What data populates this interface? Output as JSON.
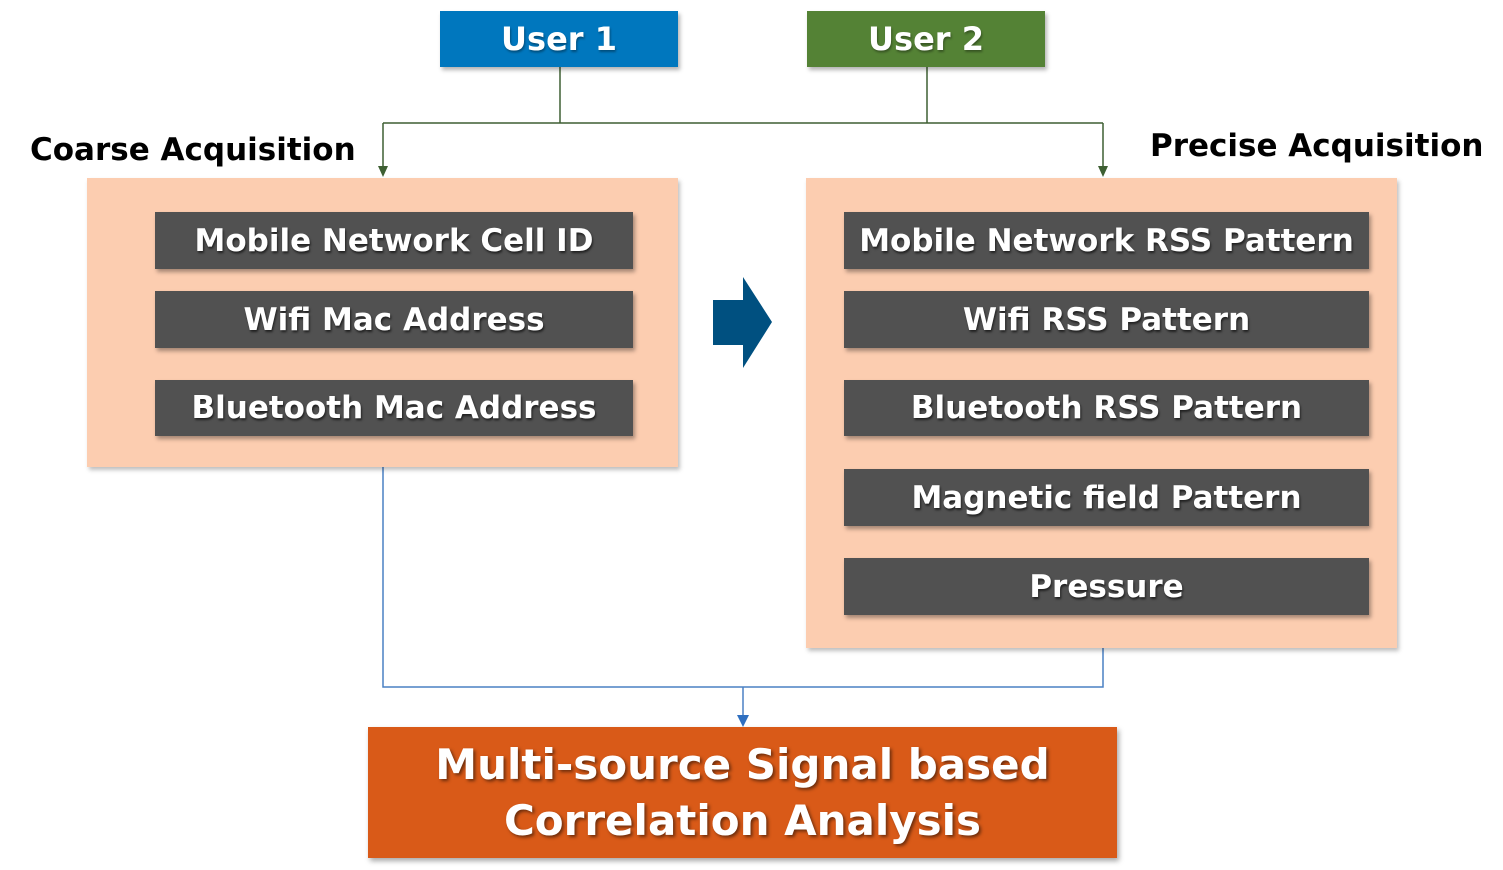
{
  "users": [
    {
      "label": "User 1",
      "color": "#0077BE"
    },
    {
      "label": "User 2",
      "color": "#548235"
    }
  ],
  "coarse": {
    "title": "Coarse Acquisition",
    "items": [
      "Mobile Network Cell ID",
      "Wifi Mac Address",
      "Bluetooth Mac Address"
    ]
  },
  "precise": {
    "title": "Precise Acquisition",
    "items": [
      "Mobile Network RSS Pattern",
      "Wifi RSS Pattern",
      "Bluetooth RSS Pattern",
      "Magnetic field Pattern",
      "Pressure"
    ]
  },
  "result": {
    "line1": "Multi-source Signal based",
    "line2": "Correlation Analysis",
    "color": "#D95A18"
  },
  "colors": {
    "panel": "#FCCDB0",
    "item": "#515151",
    "arrow": "#005080",
    "top_connector": "#3E5F32",
    "bottom_connector": "#4A80C4"
  }
}
